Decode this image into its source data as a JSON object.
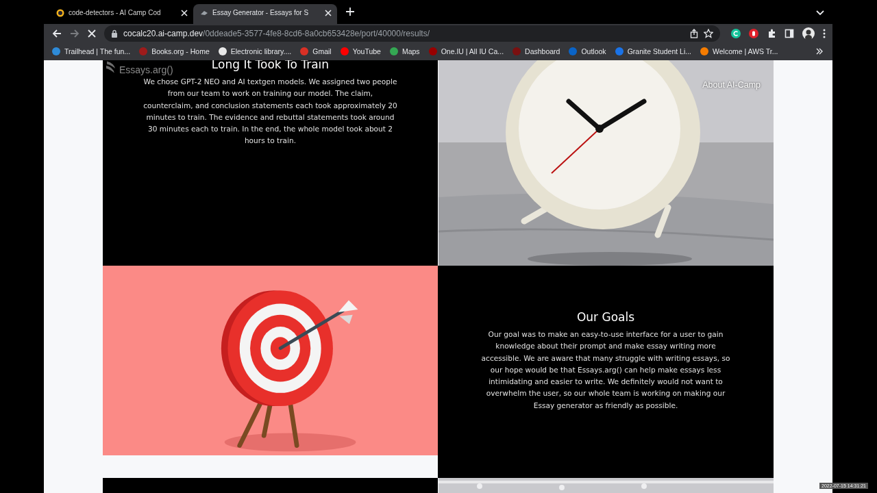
{
  "browser": {
    "tabs": [
      {
        "title": "code-detectors - AI Camp Cod",
        "selected": false
      },
      {
        "title": "Essay Generator - Essays for S",
        "selected": true
      }
    ],
    "toolbar": {
      "forward_disabled": true,
      "url": {
        "host": "cocalc20.ai-camp.dev",
        "path": "/0ddeade5-3577-4fe8-8cd6-8a0cb653428e/port/40000/results/"
      }
    },
    "bookmarks": [
      {
        "label": "Trailhead | The fun...",
        "color": "#2e8bd8"
      },
      {
        "label": "Books.org - Home",
        "color": "#9e1b1b"
      },
      {
        "label": "Electronic library....",
        "color": "#e8e8e8"
      },
      {
        "label": "Gmail",
        "color": "#d93025"
      },
      {
        "label": "YouTube",
        "color": "#ff0000"
      },
      {
        "label": "Maps",
        "color": "#34a853"
      },
      {
        "label": "One.IU | All IU Ca...",
        "color": "#990000"
      },
      {
        "label": "Dashboard",
        "color": "#7a1010"
      },
      {
        "label": "Outlook",
        "color": "#0a64c8"
      },
      {
        "label": "Granite Student Li...",
        "color": "#1a73e8"
      },
      {
        "label": "Welcome | AWS Tr...",
        "color": "#f57c00"
      }
    ]
  },
  "page": {
    "navbar": {
      "logo": "Essays.arg()",
      "links": [
        "About AI-Camp"
      ]
    },
    "sections": [
      {
        "kind": "text",
        "title": "Long It Took To Train",
        "body": "We chose GPT-2 NEO and AI textgen models. We assigned two people from our team to work on training our model. The claim, counterclaim, and conclusion statements each took approximately 20 minutes to train. The evidence and rebuttal statements took around 30 minutes each to train. In the end, the whole model took about 2 hours to train."
      },
      {
        "kind": "picture"
      },
      {
        "kind": "target"
      },
      {
        "kind": "text",
        "title": "Our Goals",
        "body": "Our goal was to make an easy-to-use interface for a user to gain knowledge about their prompt and make essay writing more accessible. We are aware that many struggle with writing essays, so our hope would be that Essays.arg() can help make essays less intimidating and easier to write. We definitely would not want to overwhelm the user, so our whole team is working on making our Essay generator as friendly as possible."
      },
      {
        "kind": "dark"
      },
      {
        "kind": "picture"
      }
    ]
  },
  "timestamp": "2022-07-15 14:31:21"
}
